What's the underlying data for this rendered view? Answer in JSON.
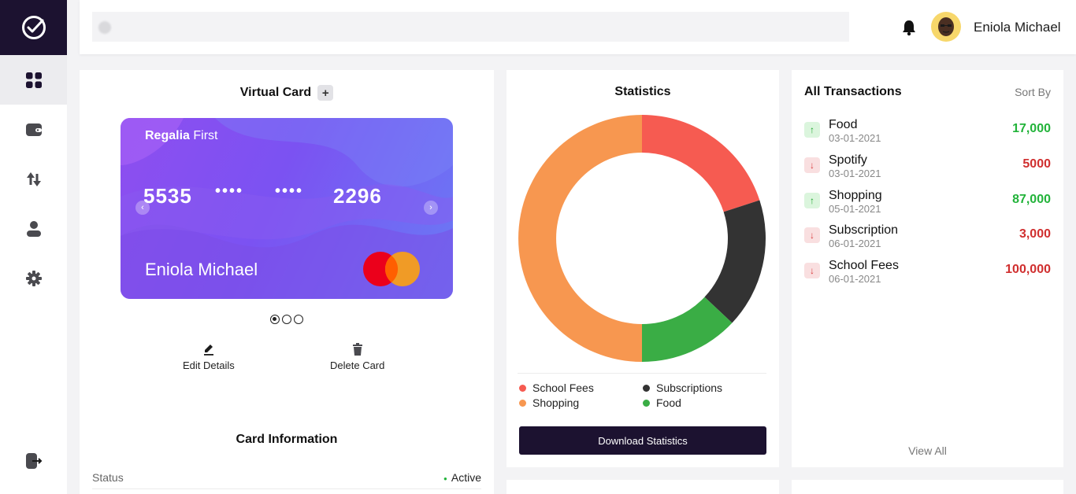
{
  "header": {
    "search_placeholder": "",
    "user_name": "Eniola Michael"
  },
  "sidebar": {
    "items": [
      {
        "name": "dashboard",
        "icon": "dashboard-grid-icon",
        "active": true
      },
      {
        "name": "wallet",
        "icon": "wallet-icon",
        "active": false
      },
      {
        "name": "transfer",
        "icon": "transfer-arrows-icon",
        "active": false
      },
      {
        "name": "profile",
        "icon": "user-icon",
        "active": false
      },
      {
        "name": "settings",
        "icon": "gear-icon",
        "active": false
      }
    ],
    "logout_icon": "logout-icon"
  },
  "virtual_card": {
    "title": "Virtual Card",
    "add_label": "+",
    "bank_bold": "Regalia",
    "bank_rest": " First",
    "num_first": "5535",
    "num_mask1": "••••",
    "num_mask2": "••••",
    "num_last": "2296",
    "holder": "Eniola Michael",
    "prev_label": "‹",
    "next_label": "›",
    "edit_label": "Edit Details",
    "delete_label": "Delete Card",
    "info_title": "Card Information",
    "status_label": "Status",
    "status_value": "Active",
    "colors": {
      "card_start": "#8e4ef0",
      "card_end": "#6a7af5",
      "status": "#22b33a"
    }
  },
  "statistics": {
    "title": "Statistics",
    "download_label": "Download Statistics",
    "legend": [
      {
        "label": "School Fees",
        "color": "#f65b51"
      },
      {
        "label": "Subscriptions",
        "color": "#333333"
      },
      {
        "label": "Shopping",
        "color": "#f79750"
      },
      {
        "label": "Food",
        "color": "#3aad45"
      }
    ],
    "shares": {
      "school_fees": 0.2,
      "subscriptions": 0.17,
      "food": 0.13,
      "shopping": 0.5
    }
  },
  "transactions": {
    "title": "All Transactions",
    "sort_label": "Sort By",
    "view_all": "View All",
    "items": [
      {
        "name": "Food",
        "date": "03-01-2021",
        "amount": "17,000",
        "direction": "up"
      },
      {
        "name": "Spotify",
        "date": "03-01-2021",
        "amount": "5000",
        "direction": "down"
      },
      {
        "name": "Shopping",
        "date": "05-01-2021",
        "amount": "87,000",
        "direction": "up"
      },
      {
        "name": "Subscription",
        "date": "06-01-2021",
        "amount": "3,000",
        "direction": "down"
      },
      {
        "name": "School Fees",
        "date": "06-01-2021",
        "amount": "100,000",
        "direction": "down"
      }
    ]
  }
}
